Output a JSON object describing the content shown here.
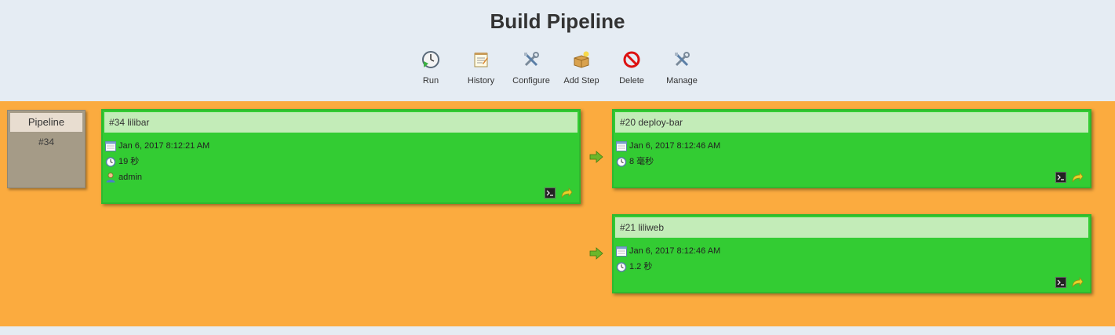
{
  "page": {
    "title": "Build Pipeline"
  },
  "toolbar": [
    {
      "name": "run",
      "label": "Run",
      "icon": "clock-run-icon"
    },
    {
      "name": "history",
      "label": "History",
      "icon": "notepad-icon"
    },
    {
      "name": "configure",
      "label": "Configure",
      "icon": "tools-icon"
    },
    {
      "name": "add-step",
      "label": "Add Step",
      "icon": "box-add-icon"
    },
    {
      "name": "delete",
      "label": "Delete",
      "icon": "no-entry-icon"
    },
    {
      "name": "manage",
      "label": "Manage",
      "icon": "tools-icon"
    }
  ],
  "pipeline": {
    "label": "Pipeline",
    "number": "#34"
  },
  "builds": [
    {
      "title": "#34 lilibar",
      "date": "Jan 6, 2017 8:12:21 AM",
      "duration": "19 秒",
      "user": "admin"
    },
    {
      "title": "#20 deploy-bar",
      "date": "Jan 6, 2017 8:12:46 AM",
      "duration": "8 毫秒"
    },
    {
      "title": "#21 liliweb",
      "date": "Jan 6, 2017 8:12:46 AM",
      "duration": "1.2 秒"
    }
  ],
  "colors": {
    "background": "#e5ecf3",
    "board": "#fbab3f",
    "success": "#33cc33",
    "card_header": "#c3ecb8"
  }
}
